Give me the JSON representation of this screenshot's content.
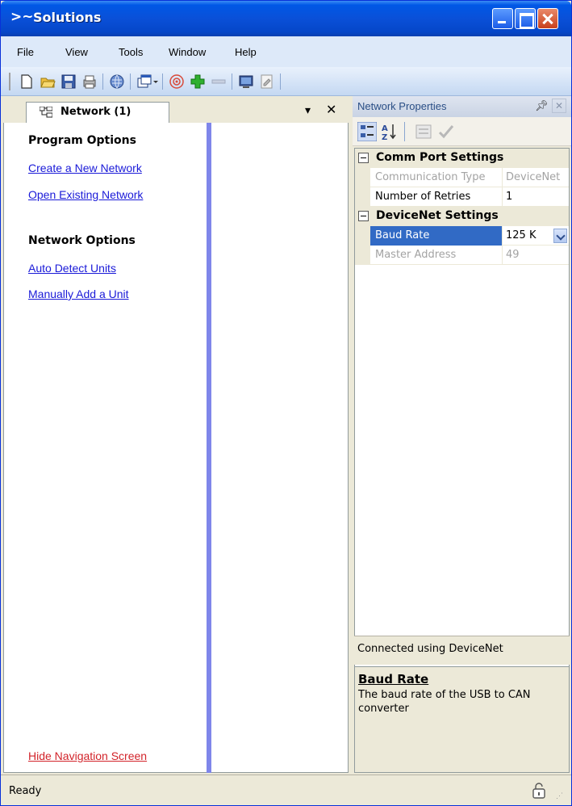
{
  "window": {
    "title": "Solutions"
  },
  "menu": {
    "items": [
      "File",
      "View",
      "Tools",
      "Window",
      "Help"
    ]
  },
  "toolbar": {
    "icons": [
      "new-document-icon",
      "open-folder-icon",
      "save-icon",
      "print-icon",
      "network-globe-icon",
      "window-stack-icon",
      "scan-icon",
      "add-icon",
      "remove-icon",
      "monitor-icon",
      "document-edit-icon"
    ]
  },
  "nav": {
    "tab_label": "Network (1)",
    "program_heading": "Program Options",
    "create_link": "Create a New Network",
    "open_link": "Open Existing Network",
    "network_heading": "Network Options",
    "auto_detect_link": "Auto Detect Units",
    "manual_add_link": "Manually Add a Unit",
    "hide_link": "Hide Navigation Screen"
  },
  "properties": {
    "title": "Network Properties",
    "categories": [
      {
        "label": "Comm Port Settings",
        "rows": [
          {
            "name": "Communication Type",
            "value": "DeviceNet",
            "disabled": true
          },
          {
            "name": "Number of Retries",
            "value": "1",
            "disabled": false
          }
        ]
      },
      {
        "label": "DeviceNet Settings",
        "rows": [
          {
            "name": "Baud Rate",
            "value": "125 K",
            "selected": true
          },
          {
            "name": "Master Address",
            "value": "49",
            "disabled": true
          }
        ]
      }
    ],
    "status": "Connected using DeviceNet",
    "help_title": "Baud Rate",
    "help_text": "The baud rate of the USB to CAN converter"
  },
  "statusbar": {
    "text": "Ready"
  },
  "colors": {
    "title_blue": "#0a50d8",
    "link_blue": "#1a1ad8",
    "link_red": "#d2232a",
    "selection": "#316ac5",
    "divider": "#7f86ea"
  }
}
